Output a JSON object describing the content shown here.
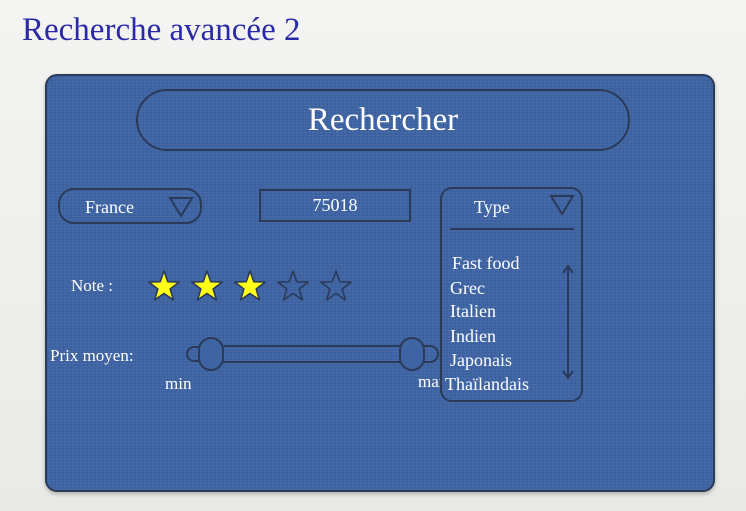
{
  "slide": {
    "title": "Recherche avancée 2"
  },
  "search_button": {
    "label": "Rechercher"
  },
  "country_select": {
    "value": "France"
  },
  "postal_code": {
    "value": "75018"
  },
  "type_select": {
    "label": "Type",
    "options": [
      "Fast food",
      "Grec",
      "Italien",
      "Indien",
      "Japonais",
      "Thaïlandais"
    ]
  },
  "rating": {
    "label": "Note :",
    "value": 3,
    "max": 5
  },
  "price": {
    "label": "Prix moyen:",
    "min_label": "min",
    "max_label": "max"
  },
  "colors": {
    "panel": "#3f64a4",
    "border": "#2b3a58",
    "title": "#2a2aa6",
    "star_fill": "#ffff1a"
  }
}
